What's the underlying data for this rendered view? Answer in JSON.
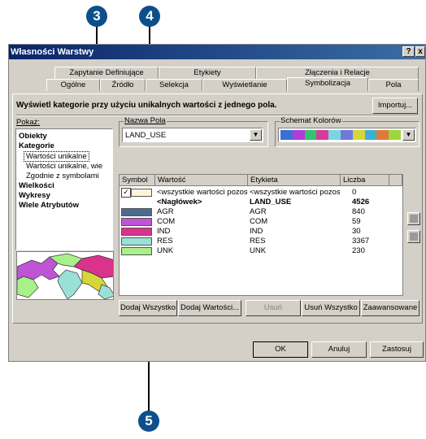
{
  "window": {
    "title": "Własności Warstwy",
    "help_label": "?",
    "close_label": "x"
  },
  "tabs": {
    "row1": [
      "Zapytanie Definiujące",
      "Etykiety",
      "Złączenia i Relacje"
    ],
    "row2": [
      "Ogólne",
      "Źródło",
      "Selekcja",
      "Wyświetlanie",
      "Symbolizacja",
      "Pola"
    ],
    "active": "Symbolizacja"
  },
  "header": {
    "description": "Wyświetl kategorie przy użyciu unikalnych wartości z jednego pola.",
    "import_label": "Importuj..."
  },
  "show": {
    "label": "Pokaż:",
    "items": [
      "Obiekty",
      "Kategorie",
      "Wartości unikalne",
      "Wartości unikalne, wie",
      "Zgodnie z symbolami",
      "Wielkości",
      "Wykresy",
      "Wiele Atrybutów"
    ]
  },
  "field": {
    "label": "Nazwa Pola",
    "value": "LAND_USE"
  },
  "color_scheme": {
    "label": "Schemat Kolorów",
    "colors": [
      "#3b6fd6",
      "#b13cd6",
      "#33c36b",
      "#d63b9c",
      "#79d6e0",
      "#6e7bd6",
      "#d6d63b",
      "#3bb0d6",
      "#e07a3b",
      "#9fd63b"
    ]
  },
  "table": {
    "headers": [
      "Symbol",
      "Wartość",
      "Etykieta",
      "Liczba"
    ],
    "rows": [
      {
        "color": "#ffffff",
        "value": "<wszystkie wartości pozosta",
        "label": "<wszystkie wartości pozosta",
        "count": "0",
        "checked": true
      },
      {
        "color": "",
        "value": "<Nagłówek>",
        "label": "LAND_USE",
        "count": "4526",
        "bold": true
      },
      {
        "color": "#4b6b8f",
        "value": "AGR",
        "label": "AGR",
        "count": "840"
      },
      {
        "color": "#c054d6",
        "value": "COM",
        "label": "COM",
        "count": "59"
      },
      {
        "color": "#d9338c",
        "value": "IND",
        "label": "IND",
        "count": "30"
      },
      {
        "color": "#9be0d6",
        "value": "RES",
        "label": "RES",
        "count": "3367"
      },
      {
        "color": "#a8f08a",
        "value": "UNK",
        "label": "UNK",
        "count": "230"
      }
    ]
  },
  "buttons": {
    "add_all": "Dodaj Wszystko",
    "add_values": "Dodaj Wartości...",
    "remove": "Usuń",
    "remove_all": "Usuń Wszystko",
    "advanced": "Zaawansowane",
    "ok": "OK",
    "cancel": "Anuluj",
    "apply": "Zastosuj"
  },
  "callouts": [
    "3",
    "4",
    "5"
  ]
}
